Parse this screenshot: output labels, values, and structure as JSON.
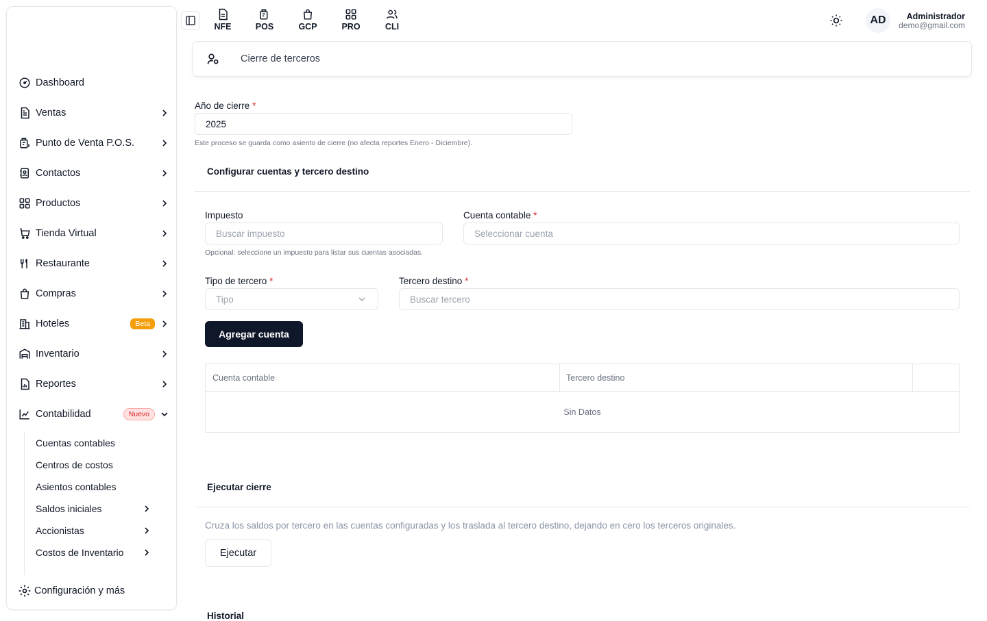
{
  "sidebar": {
    "items": [
      {
        "label": "Dashboard",
        "icon": "gauge-icon"
      },
      {
        "label": "Ventas",
        "icon": "document-icon"
      },
      {
        "label": "Punto de Venta P.O.S.",
        "icon": "pos-icon"
      },
      {
        "label": "Contactos",
        "icon": "contacts-icon"
      },
      {
        "label": "Productos",
        "icon": "grid-icon"
      },
      {
        "label": "Tienda Virtual",
        "icon": "cart-icon"
      },
      {
        "label": "Restaurante",
        "icon": "utensils-icon"
      },
      {
        "label": "Compras",
        "icon": "shopping-bag-icon"
      },
      {
        "label": "Hoteles",
        "icon": "building-icon",
        "badge": "Beta"
      },
      {
        "label": "Inventario",
        "icon": "warehouse-icon"
      },
      {
        "label": "Reportes",
        "icon": "report-icon"
      },
      {
        "label": "Contabilidad",
        "icon": "chart-icon",
        "badge": "Nuevo"
      }
    ],
    "sub_items": [
      {
        "label": "Cuentas contables"
      },
      {
        "label": "Centros de costos"
      },
      {
        "label": "Asientos contables"
      },
      {
        "label": "Saldos iniciales"
      },
      {
        "label": "Accionistas"
      },
      {
        "label": "Costos de Inventario"
      }
    ],
    "footer_label": "Configuración y más"
  },
  "topbar": {
    "modules": [
      "NFE",
      "POS",
      "GCP",
      "PRO",
      "CLI"
    ],
    "user": {
      "initials": "AD",
      "name": "Administrador",
      "email": "demo@gmail.com"
    }
  },
  "page": {
    "title": "Cierre de terceros",
    "year_label": "Año de cierre",
    "year_value": "2025",
    "year_hint": "Este proceso se guarda como asiento de cierre (no afecta reportes Enero - Diciembre).",
    "config_section": "Configurar cuentas y tercero destino",
    "tax_label": "Impuesto",
    "tax_placeholder": "Buscar impuesto",
    "tax_hint": "Opcional: seleccione un impuesto para listar sus cuentas asociadas.",
    "account_label": "Cuenta contable",
    "account_placeholder": "Seleccionar cuenta",
    "third_type_label": "Tipo de tercero",
    "third_type_placeholder": "Tipo",
    "target_label": "Tercero destino",
    "target_placeholder": "Buscar tercero",
    "add_button": "Agregar cuenta",
    "table": {
      "headers": [
        "Cuenta contable",
        "Tercero destino"
      ],
      "empty": "Sin Datos"
    },
    "run_section": "Ejecutar cierre",
    "run_desc": "Cruza los saldos por tercero en las cuentas configuradas y los traslada al tercero destino, dejando en cero los terceros originales.",
    "run_button": "Ejecutar",
    "history_section": "Historial"
  },
  "colors": {
    "primary": "#0f172a",
    "required": "#dc2626",
    "beta": "#f59e0b",
    "border": "#e5e7eb"
  }
}
